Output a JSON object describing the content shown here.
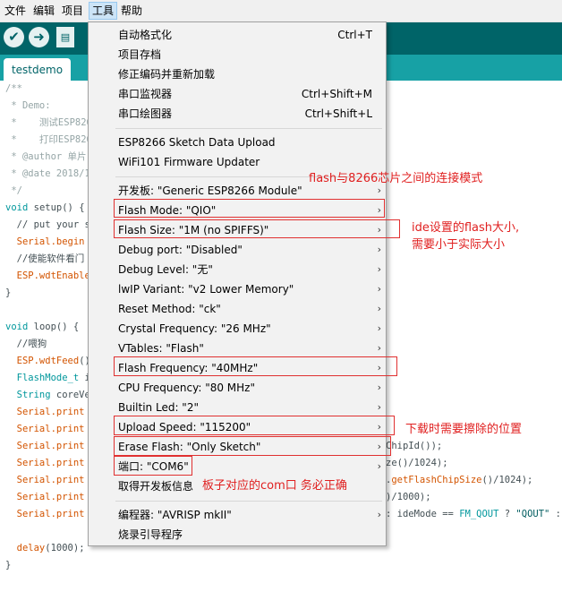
{
  "menubar": [
    {
      "label": "文件"
    },
    {
      "label": "编辑"
    },
    {
      "label": "项目"
    },
    {
      "label": "工具"
    },
    {
      "label": "帮助"
    }
  ],
  "toolbar": {
    "verify_icon": "✔",
    "upload_icon": "➜",
    "new_icon": "▤"
  },
  "tab": {
    "label": "testdemo"
  },
  "code": {
    "l1": "/**",
    "l2": " * Demo:",
    "l3": " *    测试ESP826",
    "l4": " *    打印ESP826",
    "l5": " * @author 单片",
    "l6": " * @date 2018/1",
    "l7": " */",
    "l8a": "void",
    "l8b": " setup",
    "l8c": "() {",
    "l9": "  // put your s",
    "l10a": "  Serial",
    "l10b": ".begin",
    "l11": "  //使能软件看门",
    "l12a": "  ESP",
    "l12b": ".wdtEnable",
    "l13": "}",
    "l14a": "void",
    "l14b": " loop",
    "l14c": "() {",
    "l15": "  //喂狗",
    "l16a": "  ESP",
    "l16b": ".wdtFeed",
    "l16c": "()",
    "l17a": "  FlashMode_t",
    "l17b": " i",
    "l18a": "  String",
    "l18b": " coreVe",
    "l19a": "  Serial",
    "l19b": ".print",
    "l20a": "  Serial",
    "l20b": ".print",
    "l21a": "  Serial",
    "l21b": ".print",
    "l22a": "  Serial",
    "l22b": ".print",
    "l23a": "  Serial",
    "l23b": ".print",
    "l24a": "  Serial",
    "l24b": ".print",
    "l25a": "  Serial",
    "l25b": ".print",
    "l26a": "  delay",
    "l26b": "(1000);",
    "l27": "}",
    "r1": "ChipId());",
    "r2": "ze()/1024);",
    "r3a": ".",
    "r3b": "getFlashChipSize",
    "r3c": "()/1024);",
    "r4": ")/1000);",
    "r5a": ": ideMode == ",
    "r5b": "FM_QOUT",
    "r5c": " ? ",
    "r5d": "\"QOUT\"",
    "r5e": " : i"
  },
  "menu": {
    "items": [
      {
        "label": "自动格式化",
        "shortcut": "Ctrl+T"
      },
      {
        "label": "项目存档",
        "shortcut": ""
      },
      {
        "label": "修正编码并重新加载",
        "shortcut": ""
      },
      {
        "label": "串口监视器",
        "shortcut": "Ctrl+Shift+M"
      },
      {
        "label": "串口绘图器",
        "shortcut": "Ctrl+Shift+L"
      },
      {
        "label": "ESP8266 Sketch Data Upload",
        "shortcut": ""
      },
      {
        "label": "WiFi101 Firmware Updater",
        "shortcut": ""
      },
      {
        "label": "开发板: \"Generic ESP8266 Module\"",
        "shortcut": ""
      },
      {
        "label": "Flash Mode: \"QIO\"",
        "shortcut": ""
      },
      {
        "label": "Flash Size: \"1M (no SPIFFS)\"",
        "shortcut": ""
      },
      {
        "label": "Debug port: \"Disabled\"",
        "shortcut": ""
      },
      {
        "label": "Debug Level: \"无\"",
        "shortcut": ""
      },
      {
        "label": "lwIP Variant: \"v2 Lower Memory\"",
        "shortcut": ""
      },
      {
        "label": "Reset Method: \"ck\"",
        "shortcut": ""
      },
      {
        "label": "Crystal Frequency: \"26 MHz\"",
        "shortcut": ""
      },
      {
        "label": "VTables: \"Flash\"",
        "shortcut": ""
      },
      {
        "label": "Flash Frequency: \"40MHz\"",
        "shortcut": ""
      },
      {
        "label": "CPU Frequency: \"80 MHz\"",
        "shortcut": ""
      },
      {
        "label": "Builtin Led: \"2\"",
        "shortcut": ""
      },
      {
        "label": "Upload Speed: \"115200\"",
        "shortcut": ""
      },
      {
        "label": "Erase Flash: \"Only Sketch\"",
        "shortcut": ""
      },
      {
        "label": "端口: \"COM6\"",
        "shortcut": ""
      },
      {
        "label": "取得开发板信息",
        "shortcut": ""
      },
      {
        "label": "编程器: \"AVRISP mkII\"",
        "shortcut": ""
      },
      {
        "label": "烧录引导程序",
        "shortcut": ""
      }
    ],
    "arrow_glyph": "›"
  },
  "annotations": {
    "flash_mode": "flash与8266芯片之间的连接模式",
    "flash_size_1": "ide设置的flash大小,",
    "flash_size_2": "需要小于实际大小",
    "erase": "下载时需要擦除的位置",
    "port": "板子对应的com口 务必正确"
  },
  "colors": {
    "toolbar": "#006468",
    "tabbar": "#17a1a5",
    "annotation": "#e02020"
  }
}
